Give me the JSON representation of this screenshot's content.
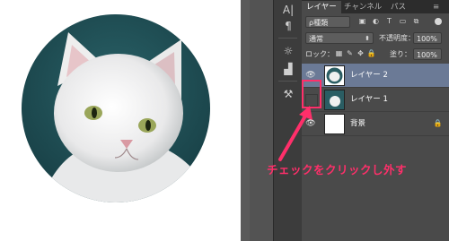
{
  "tabs": [
    "レイヤー",
    "チャンネル",
    "パス"
  ],
  "filter": {
    "kind_label": "ρ種類"
  },
  "blend": {
    "mode": "通常",
    "opacity_label": "不透明度：",
    "opacity_value": "100%"
  },
  "lock": {
    "label": "ロック：",
    "fill_label": "塗り：",
    "fill_value": "100%"
  },
  "layers": [
    {
      "name": "レイヤー 2",
      "visible": true,
      "selected": true
    },
    {
      "name": "レイヤー 1",
      "visible": false,
      "selected": false
    },
    {
      "name": "背景",
      "visible": true,
      "selected": false
    }
  ],
  "annotation": {
    "text": "チェックをクリックし外す",
    "color": "#ff2f6a"
  },
  "colors": {
    "selected_row": "#6b7a96",
    "accent": "#ff2f6a",
    "teal_bg": "#1f4f55"
  }
}
